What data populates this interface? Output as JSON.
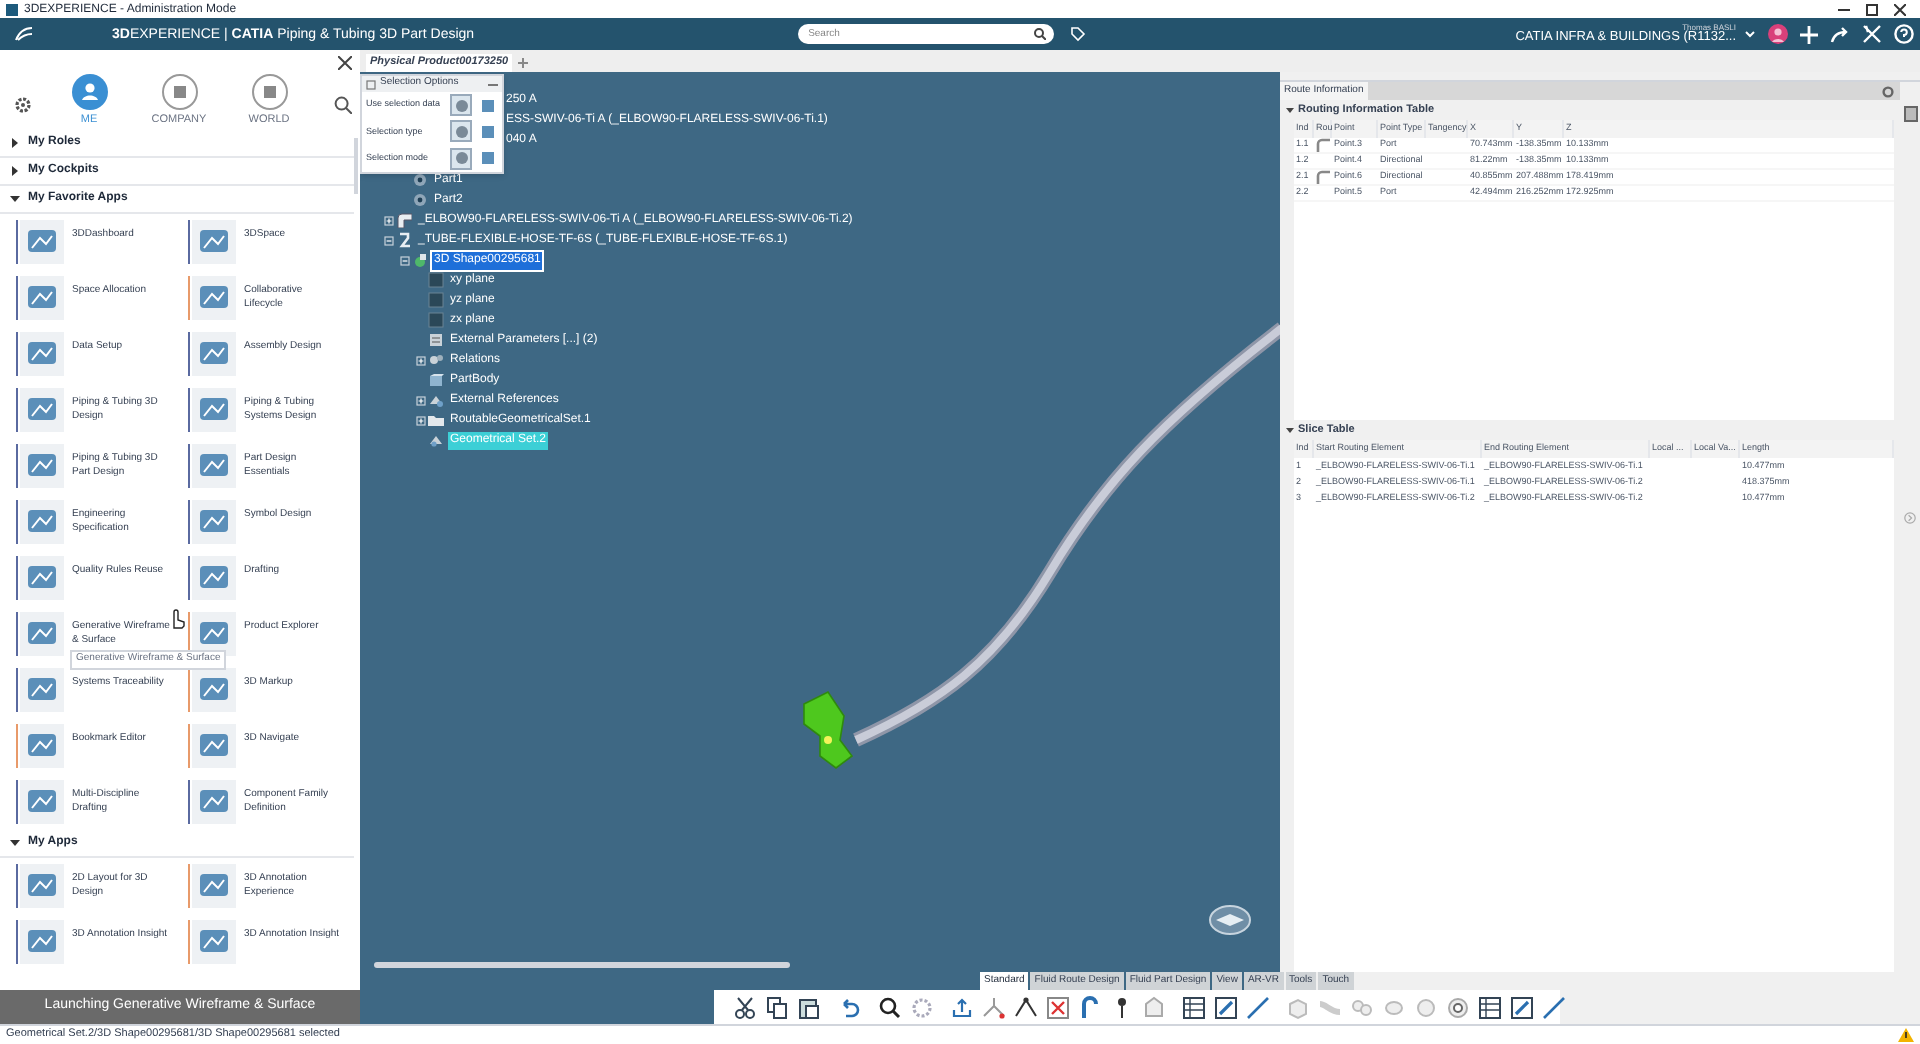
{
  "window": {
    "title": "3DEXPERIENCE - Administration Mode"
  },
  "top_bar": {
    "title": "**3D**EXPERIENCE | **CATIA** Piping & Tubing 3D Part Design",
    "search": {
      "placeholder": "Search"
    },
    "user": "Thomas BASLI",
    "collaborative_space": "CATIA INFRA & BUILDINGS (R1132..."
  },
  "compass_panel": {
    "tabs": [
      {
        "label": "ME",
        "selected": true
      },
      {
        "label": "COMPANY",
        "selected": false
      },
      {
        "label": "WORLD",
        "selected": false
      }
    ],
    "sections": [
      {
        "label": "My Roles",
        "expanded": false
      },
      {
        "label": "My Cockpits",
        "expanded": false
      },
      {
        "label": "My Favorite Apps",
        "expanded": true,
        "apps": [
          {
            "label": "3DDashboard",
            "color": "#5a6aa0"
          },
          {
            "label": "3DSpace",
            "color": "#5a6aa0"
          },
          {
            "label": "Space Allocation",
            "color": "#5a6aa0"
          },
          {
            "label": "Collaborative Lifecycle",
            "color": "#e89a6a"
          },
          {
            "label": "Data Setup",
            "color": "#5a6aa0"
          },
          {
            "label": "Assembly Design",
            "color": "#5a6aa0"
          },
          {
            "label": "Piping & Tubing 3D Design",
            "color": "#5a6aa0"
          },
          {
            "label": "Piping & Tubing Systems Design",
            "color": "#5a6aa0"
          },
          {
            "label": "Piping & Tubing 3D Part Design",
            "color": "#5a6aa0"
          },
          {
            "label": "Part Design Essentials",
            "color": "#5a6aa0"
          },
          {
            "label": "Engineering Specification",
            "color": "#5a6aa0"
          },
          {
            "label": "Symbol Design",
            "color": "#5a6aa0"
          },
          {
            "label": "Quality Rules Reuse",
            "color": "#5a6aa0"
          },
          {
            "label": "Drafting",
            "color": "#5a6aa0"
          },
          {
            "label": "Generative Wireframe & Surface",
            "color": "#5a6aa0",
            "tooltip": "Generative Wireframe & Surface"
          },
          {
            "label": "Product Explorer",
            "color": "#e89a6a"
          },
          {
            "label": "Systems Traceability",
            "color": "#5a6aa0"
          },
          {
            "label": "3D Markup",
            "color": "#e89a6a"
          },
          {
            "label": "Bookmark Editor",
            "color": "#e89a6a"
          },
          {
            "label": "3D Navigate",
            "color": "#e89a6a"
          },
          {
            "label": "Multi-Discipline Drafting",
            "color": "#5a6aa0"
          },
          {
            "label": "Component Family Definition",
            "color": "#5a6aa0"
          }
        ]
      },
      {
        "label": "My Apps",
        "expanded": true,
        "apps": [
          {
            "label": "2D Layout for 3D Design",
            "color": "#5a6aa0"
          },
          {
            "label": "3D Annotation Experience",
            "color": "#e89a6a"
          },
          {
            "label": "3D Annotation Insight",
            "color": "#5a6aa0"
          },
          {
            "label": "3D Annotation Insight",
            "color": "#e89a6a"
          }
        ]
      }
    ],
    "notification": "Launching Generative Wireframe & Surface"
  },
  "document_tab": {
    "label": "Physical Product00173250"
  },
  "tree": [
    {
      "label": "250 A",
      "kind": "partial",
      "children": [
        {
          "label": "ESS-SWIV-06-Ti A (_ELBOW90-FLARELESS-SWIV-06-Ti.1)",
          "kind": "partial"
        },
        {
          "label": "040 A",
          "kind": "partial",
          "children": [
            {
              "label": "Part1",
              "kind": "port",
              "selected": false,
              "preselected": false
            },
            {
              "label": "Part2",
              "kind": "port",
              "selected": false,
              "preselected": false
            }
          ]
        },
        {
          "label": "_ELBOW90-FLARELESS-SWIV-06-Ti A (_ELBOW90-FLARELESS-SWIV-06-Ti.2)",
          "kind": "component",
          "expanded": false,
          "selected": false,
          "preselected": false
        },
        {
          "label": "_TUBE-FLEXIBLE-HOSE-TF-6S (_TUBE-FLEXIBLE-HOSE-TF-6S.1)",
          "kind": "tube",
          "expanded": true,
          "selected": false,
          "preselected": false,
          "children": [
            {
              "label": "3D Shape00295681",
              "kind": "shape",
              "expanded": true,
              "selected": true,
              "preselected": false,
              "children": [
                {
                  "label": "xy plane",
                  "kind": "plane",
                  "selected": false,
                  "preselected": false
                },
                {
                  "label": "yz plane",
                  "kind": "plane",
                  "selected": false,
                  "preselected": false
                },
                {
                  "label": "zx plane",
                  "kind": "plane",
                  "selected": false,
                  "preselected": false
                },
                {
                  "label": "External Parameters [...] (2)",
                  "kind": "parameters",
                  "selected": false,
                  "preselected": false
                },
                {
                  "label": "Relations",
                  "kind": "relations",
                  "expanded": false,
                  "selected": false,
                  "preselected": false
                },
                {
                  "label": "PartBody",
                  "kind": "body",
                  "selected": false,
                  "preselected": false
                },
                {
                  "label": "External References",
                  "kind": "references",
                  "expanded": false,
                  "selected": false,
                  "preselected": false
                },
                {
                  "label": "RoutableGeometricalSet.1",
                  "kind": "folder",
                  "expanded": false,
                  "selected": false,
                  "preselected": false
                },
                {
                  "label": "Geometrical Set.2",
                  "kind": "geoset",
                  "selected": false,
                  "preselected": true
                }
              ]
            }
          ]
        }
      ]
    }
  ],
  "selection_options": {
    "title": "Selection Options",
    "rows": [
      "Use selection data",
      "Selection type",
      "Selection mode"
    ]
  },
  "route_information": {
    "tab": "Route Information",
    "routing_table": {
      "title": "Routing Information Table",
      "columns": [
        "Ind",
        "Rou",
        "Point",
        "Point Type",
        "Tangency",
        "X",
        "Y",
        "Z"
      ],
      "rows": [
        {
          "ind": "1.1",
          "route_icon": true,
          "point": "Point.3",
          "point_type": "Port",
          "x": "70.743mm",
          "y": "-138.35mm",
          "z": "10.133mm"
        },
        {
          "ind": "1.2",
          "route_icon": false,
          "point": "Point.4",
          "point_type": "Directional",
          "x": "81.22mm",
          "y": "-138.35mm",
          "z": "10.133mm"
        },
        {
          "ind": "2.1",
          "route_icon": true,
          "point": "Point.6",
          "point_type": "Directional",
          "x": "40.855mm",
          "y": "207.488mm",
          "z": "178.419mm"
        },
        {
          "ind": "2.2",
          "route_icon": false,
          "point": "Point.5",
          "point_type": "Port",
          "x": "42.494mm",
          "y": "216.252mm",
          "z": "172.925mm"
        }
      ]
    },
    "slice_table": {
      "title": "Slice Table",
      "columns": [
        "Ind",
        "Start Routing Element",
        "End Routing Element",
        "Local ...",
        "Local Va...",
        "Length"
      ],
      "rows": [
        {
          "ind": "1",
          "start": "_ELBOW90-FLARELESS-SWIV-06-Ti.1",
          "end": "_ELBOW90-FLARELESS-SWIV-06-Ti.1",
          "length": "10.477mm"
        },
        {
          "ind": "2",
          "start": "_ELBOW90-FLARELESS-SWIV-06-Ti.1",
          "end": "_ELBOW90-FLARELESS-SWIV-06-Ti.2",
          "length": "418.375mm"
        },
        {
          "ind": "3",
          "start": "_ELBOW90-FLARELESS-SWIV-06-Ti.2",
          "end": "_ELBOW90-FLARELESS-SWIV-06-Ti.2",
          "length": "10.477mm"
        }
      ]
    }
  },
  "toolbar_tabs": [
    {
      "label": "Standard",
      "selected": true
    },
    {
      "label": "Fluid Route Design",
      "selected": false
    },
    {
      "label": "Fluid Part Design",
      "selected": false
    },
    {
      "label": "View",
      "selected": false
    },
    {
      "label": "AR-VR",
      "selected": false
    },
    {
      "label": "Tools",
      "selected": false
    },
    {
      "label": "Touch",
      "selected": false
    }
  ],
  "status_bar": "Geometrical Set.2/3D Shape00295681/3D Shape00295681 selected"
}
